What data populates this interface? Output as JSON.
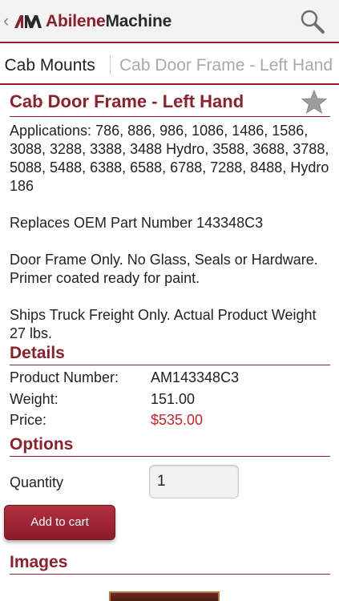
{
  "appbar": {
    "title_part1": "Abilene",
    "title_part2": "Machine",
    "back_glyph": "‹",
    "logo_icon": "am-logo-icon",
    "search_icon": "search-icon"
  },
  "breadcrumb": {
    "previous": "Cab and Cab Mounts",
    "previous_visible": "d Cab Mounts",
    "current": "Cab Door Frame - Left Hand"
  },
  "product": {
    "title": "Cab Door Frame - Left Hand",
    "favorite_icon": "star-icon",
    "description": [
      "Applications: 786, 886, 986, 1086, 1486, 1586, 3088, 3288, 3388, 3488 Hydro, 3588, 3688, 3788, 5088, 5488, 6388, 6588, 6788, 7288, 8488, Hydro 186",
      "Replaces OEM Part Number 143348C3",
      "Door Frame Only. No Glass, Seals or Hardware. Primer coated ready for paint.",
      "Ships Truck Freight Only. Actual Product Weight 27 lbs."
    ]
  },
  "details": {
    "heading": "Details",
    "rows": [
      {
        "key": "Product Number:",
        "value": "AM143348C3"
      },
      {
        "key": "Weight:",
        "value": "151.00"
      },
      {
        "key": "Price:",
        "value": "$535.00"
      }
    ]
  },
  "options": {
    "heading": "Options",
    "quantity_label": "Quantity",
    "quantity_value": "1",
    "add_to_cart_label": "Add to cart"
  },
  "images": {
    "heading": "Images"
  },
  "colors": {
    "brand": "#8e1f2c",
    "price": "#d02028",
    "breadcrumb_inactive": "#a9a9a9"
  }
}
